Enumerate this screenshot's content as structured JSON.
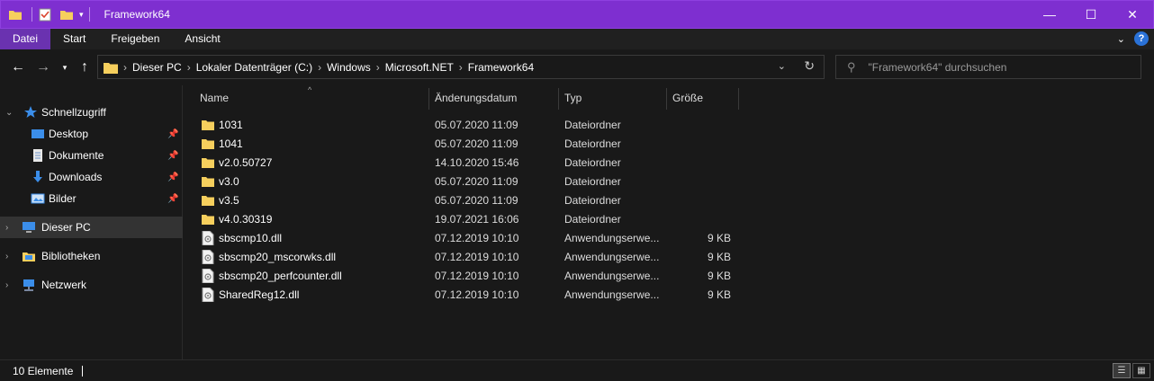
{
  "window": {
    "title": "Framework64",
    "controls": {
      "minimize": "—",
      "maximize": "☐",
      "close": "✕"
    }
  },
  "colors": {
    "titlebar": "#7e2fd0",
    "active_tab": "#6a32b0",
    "folder": "#f6cf5d",
    "background": "#191919"
  },
  "ribbon": {
    "tabs": [
      {
        "label": "Datei",
        "active": true
      },
      {
        "label": "Start",
        "active": false
      },
      {
        "label": "Freigeben",
        "active": false
      },
      {
        "label": "Ansicht",
        "active": false
      }
    ],
    "help": "?"
  },
  "address": {
    "crumbs": [
      "Dieser PC",
      "Lokaler Datenträger (C:)",
      "Windows",
      "Microsoft.NET",
      "Framework64"
    ],
    "separator": "›"
  },
  "search": {
    "placeholder": "\"Framework64\" durchsuchen"
  },
  "nav": {
    "items": [
      {
        "label": "Schnellzugriff",
        "icon": "star-icon"
      },
      {
        "label": "Desktop",
        "icon": "desktop-icon",
        "pinned": true
      },
      {
        "label": "Dokumente",
        "icon": "document-icon",
        "pinned": true
      },
      {
        "label": "Downloads",
        "icon": "download-icon",
        "pinned": true
      },
      {
        "label": "Bilder",
        "icon": "pictures-icon",
        "pinned": true
      },
      {
        "label": "Dieser PC",
        "icon": "computer-icon",
        "selected": true
      },
      {
        "label": "Bibliotheken",
        "icon": "library-icon"
      },
      {
        "label": "Netzwerk",
        "icon": "network-icon"
      }
    ]
  },
  "columns": {
    "name": "Name",
    "date": "Änderungsdatum",
    "type": "Typ",
    "size": "Größe"
  },
  "files": [
    {
      "name": "1031",
      "date": "05.07.2020 11:09",
      "type": "Dateiordner",
      "size": "",
      "kind": "folder"
    },
    {
      "name": "1041",
      "date": "05.07.2020 11:09",
      "type": "Dateiordner",
      "size": "",
      "kind": "folder"
    },
    {
      "name": "v2.0.50727",
      "date": "14.10.2020 15:46",
      "type": "Dateiordner",
      "size": "",
      "kind": "folder"
    },
    {
      "name": "v3.0",
      "date": "05.07.2020 11:09",
      "type": "Dateiordner",
      "size": "",
      "kind": "folder"
    },
    {
      "name": "v3.5",
      "date": "05.07.2020 11:09",
      "type": "Dateiordner",
      "size": "",
      "kind": "folder"
    },
    {
      "name": "v4.0.30319",
      "date": "19.07.2021 16:06",
      "type": "Dateiordner",
      "size": "",
      "kind": "folder"
    },
    {
      "name": "sbscmp10.dll",
      "date": "07.12.2019 10:10",
      "type": "Anwendungserwe...",
      "size": "9 KB",
      "kind": "dll"
    },
    {
      "name": "sbscmp20_mscorwks.dll",
      "date": "07.12.2019 10:10",
      "type": "Anwendungserwe...",
      "size": "9 KB",
      "kind": "dll"
    },
    {
      "name": "sbscmp20_perfcounter.dll",
      "date": "07.12.2019 10:10",
      "type": "Anwendungserwe...",
      "size": "9 KB",
      "kind": "dll"
    },
    {
      "name": "SharedReg12.dll",
      "date": "07.12.2019 10:10",
      "type": "Anwendungserwe...",
      "size": "9 KB",
      "kind": "dll"
    }
  ],
  "status": {
    "count": "10 Elemente"
  }
}
